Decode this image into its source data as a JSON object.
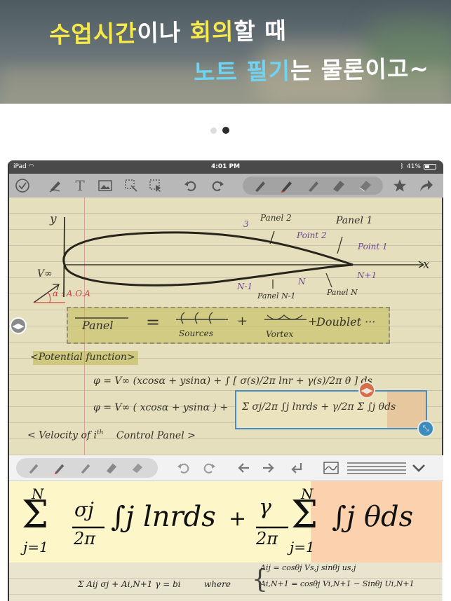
{
  "hero": {
    "line1_highlight": "수업시간",
    "line1_mid": "이나 ",
    "line1_highlight2": "회의",
    "line1_rest": "할 때",
    "line2_highlight": "노트 필기",
    "line2_rest": "는 물론이고~"
  },
  "status_bar": {
    "device": "iPad",
    "time": "4:01 PM",
    "battery": "41%"
  },
  "toolbar": {
    "icons": [
      "check-icon",
      "pen-icon",
      "text-icon",
      "image-icon",
      "lasso-icon",
      "select-icon",
      "undo-icon",
      "redo-icon",
      "pencil-icon",
      "pen-red-icon",
      "marker-icon",
      "highlighter-icon",
      "eraser-icon",
      "star-icon",
      "share-icon"
    ]
  },
  "note": {
    "airfoil": {
      "y_label": "y",
      "x_label": "x",
      "v_inf": "V∞",
      "alpha": "α : A.O.A",
      "panel2": "Panel 2",
      "panel1": "Panel 1",
      "three": "3",
      "point2": "Point 2",
      "point1": "Point 1",
      "n_plus_1": "N+1",
      "n_minus_1": "N-1",
      "n": "N",
      "panel_n_minus_1": "Panel N-1",
      "panel_n": "Panel N"
    },
    "panel_eq": {
      "panel": "Panel",
      "equals": "=",
      "sources": "Sources",
      "plus1": "+",
      "vortex": "Vortex",
      "plus2": "+",
      "doublet": "Doublet ···"
    },
    "potential_title": "<Potential function>",
    "phi_line1": "φ = V∞ (xcosα + ysinα) + ∫ [ σ(s)/2π lnr + γ(s)/2π θ ] ds",
    "phi_line2_left": "φ = V∞ ( xcosα + ysinα ) +",
    "selection_formula": "Σ σj/2π ∫j lnrds + γ/2π Σ ∫j θds",
    "velocity_title": "< Velocity of i",
    "velocity_sup": "th",
    "velocity_rest": "Control Panel >"
  },
  "input_panel": {
    "tools": [
      "pencil-icon",
      "pen-red-icon",
      "marker-icon",
      "highlighter-icon",
      "eraser-icon"
    ],
    "nav": [
      "undo-icon",
      "redo-icon",
      "left-arrow-icon",
      "right-arrow-icon",
      "return-icon",
      "graph-icon",
      "lines-icon",
      "chevron-down-icon"
    ],
    "formula_sum1_top": "N",
    "formula_sum1_bottom": "j=1",
    "formula_frac1_num": "σj",
    "formula_frac1_den": "2π",
    "formula_int1": "∫j lnrds",
    "formula_plus": "+",
    "formula_frac2_num": "γ",
    "formula_frac2_den": "2π",
    "formula_sum2_top": "N",
    "formula_sum2_bottom": "j=1",
    "formula_int2": "∫j θds"
  },
  "bottom_note": {
    "sum_eq": "Σ Aij σj + Ai,N+1 γ = bi",
    "where": "where",
    "aij": "Aij = cosθj Vs,j   sinθj us,j",
    "ai_n1": "Ai,N+1 = cosθj Vi,N+1 − Sinθj Ui,N+1"
  },
  "colors": {
    "highlight_yellow": "#f7e94a",
    "highlight_cyan": "#6fd3f2",
    "paper": "#f9f4d6",
    "selection_blue": "#3a8ee6",
    "handle_orange": "#e96a4a"
  }
}
